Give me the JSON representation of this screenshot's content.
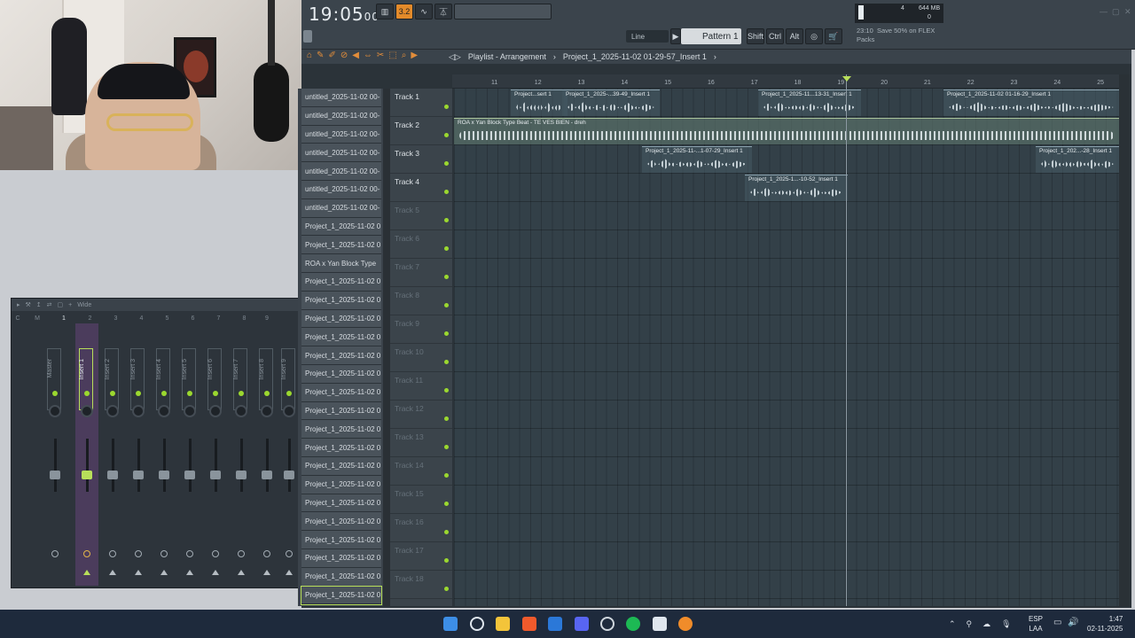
{
  "topbar": {
    "time": "19:05",
    "time_small": "00",
    "pattern": "Pattern 1",
    "snap": "Line",
    "modifiers": [
      "Shift",
      "Ctrl",
      "Alt"
    ],
    "cpu_ram": "644 MB",
    "cpu_num": "4",
    "cpu_zero": "0",
    "hint_time": "23:10",
    "hint_text": "Save 50% on FLEX",
    "hint_text2": "Packs",
    "tempo_box": "3.2"
  },
  "playlist": {
    "title": "Playlist - Arrangement",
    "project": "Project_1_2025-11-02 01-29-57_Insert 1",
    "ruler": [
      "11",
      "12",
      "13",
      "14",
      "15",
      "16",
      "17",
      "18",
      "19",
      "20",
      "21",
      "22",
      "23",
      "24",
      "25"
    ],
    "tracks": [
      "Track 1",
      "Track 2",
      "Track 3",
      "Track 4",
      "Track 5",
      "Track 6",
      "Track 7",
      "Track 8",
      "Track 9",
      "Track 10",
      "Track 11",
      "Track 12",
      "Track 13",
      "Track 14",
      "Track 15",
      "Track 16",
      "Track 17",
      "Track 18"
    ],
    "clips": [
      {
        "name": "Project...sert 1"
      },
      {
        "name": "Project_1_2025-...39-49_Insert 1"
      },
      {
        "name": "Project_1_2025-11...13-31_Insert 1"
      },
      {
        "name": "Project_1_2025-11-02 01-16-29_Insert 1"
      },
      {
        "name": "ROA x Yan Block Type Beat - TE VES BIEN - dreh"
      },
      {
        "name": "Project_1_2025-11-...1-07-29_Insert 1"
      },
      {
        "name": "Project_1_202...-28_Insert 1"
      },
      {
        "name": "Project_1_2025-1...-10-52_Insert 1"
      }
    ]
  },
  "browser": {
    "items": [
      "untitled_2025-11-02 00-",
      "untitled_2025-11-02 00-",
      "untitled_2025-11-02 00-",
      "untitled_2025-11-02 00-",
      "untitled_2025-11-02 00-",
      "untitled_2025-11-02 00-",
      "untitled_2025-11-02 00-",
      "Project_1_2025-11-02 0",
      "Project_1_2025-11-02 0",
      "ROA x Yan Block Type",
      "Project_1_2025-11-02 0",
      "Project_1_2025-11-02 0",
      "Project_1_2025-11-02 0",
      "Project_1_2025-11-02 0",
      "Project_1_2025-11-02 0",
      "Project_1_2025-11-02 0",
      "Project_1_2025-11-02 0",
      "Project_1_2025-11-02 0",
      "Project_1_2025-11-02 0",
      "Project_1_2025-11-02 0",
      "Project_1_2025-11-02 0",
      "Project_1_2025-11-02 0",
      "Project_1_2025-11-02 0",
      "Project_1_2025-11-02 0",
      "Project_1_2025-11-02 0",
      "Project_1_2025-11-02 0",
      "Project_1_2025-11-02 0",
      "Project_1_2025-11-02 0"
    ]
  },
  "mixer": {
    "toolbar_label": "Wide",
    "header": [
      "C",
      "M",
      "1",
      "2",
      "3",
      "4",
      "5",
      "6",
      "7",
      "8",
      "9"
    ],
    "strips": [
      "Master",
      "Insert 1",
      "Insert 2",
      "Insert 3",
      "Insert 4",
      "Insert 5",
      "Insert 6",
      "Insert 7",
      "Insert 8",
      "Insert 9"
    ]
  },
  "taskbar": {
    "lang1": "ESP",
    "lang2": "LAA",
    "time": "1:47",
    "date": "02-11-2025"
  }
}
